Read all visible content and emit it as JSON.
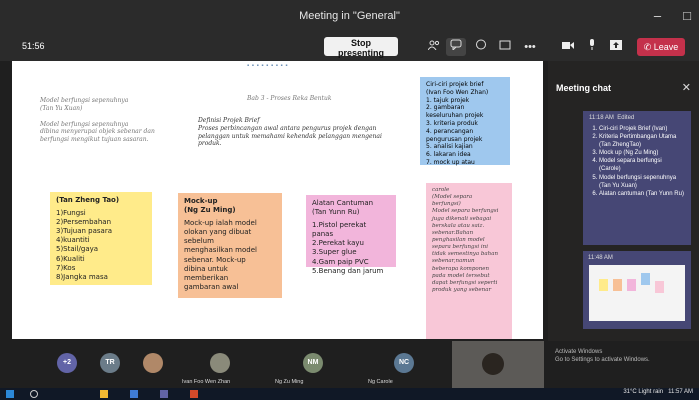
{
  "window": {
    "title": "Meeting in \"General\"",
    "controls": [
      "–",
      "□"
    ]
  },
  "meeting": {
    "timer": "51:56",
    "stop_label": "Stop presenting",
    "leave_label": "Leave",
    "toolbar_icons": [
      "participants-icon",
      "chat-icon",
      "reactions-icon",
      "rooms-icon",
      "more-icon",
      "camera-icon",
      "mic-icon",
      "share-icon"
    ]
  },
  "share": {
    "top_left_notes": [
      "Model berfungsi sepenuhnya",
      "(Tan Yu Xuan)",
      "Model berfungsi sepenuhnya",
      "dibina menyerupai objek sebenar dan",
      "berfungsi mengikut tujuan sasaran."
    ],
    "center_title": "Bab 3 - Proses Reka Bentuk",
    "brief_heading": "Definisi Projek Brief",
    "brief_text": [
      "Proses perbincangan awal antara pengurus projek dengan",
      "pelanggan untuk memahami kehendak pelanggan mengenai",
      "produk."
    ],
    "blue_note": {
      "title": "Ciri-ciri projek brief",
      "author": "(Ivan Foo Wen Zhan)",
      "items": [
        "1.    tajuk projek",
        "2.      gambaran",
        "keseluruhan projek",
        "3.      kriteria produk",
        "4.      perancangan",
        "pengurusan projek",
        "5.      analisi kajian",
        "6.      lakaran idea",
        "7.      mock up atau"
      ]
    },
    "yellow_note": {
      "title": "(Tan Zheng Tao)",
      "items": [
        "1)Fungsi",
        "2)Persembahan",
        "3)Tujuan pasara",
        "4)kuantiti",
        "5)Stail/gaya",
        "6)Kualiti",
        "7)Kos",
        "8)Jangka masa"
      ]
    },
    "orange_note": {
      "title": "Mock-up",
      "author": "(Ng Zu Ming)",
      "body": [
        "Mock-up ialah model",
        "olokan yang dibuat",
        "sebelum",
        "menghasilkan model",
        "sebenar. Mock-up",
        "dibina untuk",
        "memberikan",
        "gambaran awal"
      ]
    },
    "pink_note": {
      "title": "Alatan Cantuman",
      "author": "(Tan Yunn Ru)",
      "items": [
        "1.Pistol perekat",
        "panas",
        "2.Perekat kayu",
        "3.Super glue",
        "4.Gam paip PVC",
        "5.Benang dan jarum"
      ]
    },
    "pink2_note": {
      "lines": [
        "carole",
        "(Model separa",
        "berfungsi)",
        "Model separa berfungsi",
        "juga dikenali sebagai",
        "berskala atau saiz.",
        "sebenar.Bahan",
        "penghasilan model",
        "separa berfungsi ini",
        "tidak semestinya bahan",
        "sebenar,namun",
        "beberapa komponen",
        "pada model tersebut",
        "dapat berfungsi seperti",
        "produk yang sebenar"
      ]
    }
  },
  "chat": {
    "title": "Meeting chat",
    "message1": {
      "time": "11:18 AM",
      "edited": "Edited",
      "items": [
        "Ciri-ciri Projek Brief (Ivan)",
        "Kriteria Pertimbangan Utama (Tan ZhengTao)",
        "Mock up (Ng Zu Ming)",
        "Model separa berfungsi (Carole)",
        "Model berfungsi sepenuhnya (Tan Yu Xuan)",
        "Alatan cantuman (Tan Yunn Ru)"
      ]
    },
    "message2": {
      "time": "11:48 AM"
    }
  },
  "participants": {
    "overflow": "+2",
    "tiles": [
      {
        "initials": "TR",
        "name": ""
      },
      {
        "initials": "",
        "name": ""
      },
      {
        "initials": "",
        "name": "Ivan Foo Wen Zhan"
      },
      {
        "initials": "NM",
        "name": "Ng Zu Ming"
      },
      {
        "initials": "NC",
        "name": "Ng Carole"
      }
    ]
  },
  "watermark": [
    "Activate Windows",
    "Go to Settings to activate Windows."
  ],
  "taskbar": {
    "weather": "31°C  Light rain",
    "clock": "11:57 AM"
  },
  "colors": {
    "leave": "#c4314b",
    "chat_bubble": "#464775",
    "teams_purple": "#6264a7"
  }
}
